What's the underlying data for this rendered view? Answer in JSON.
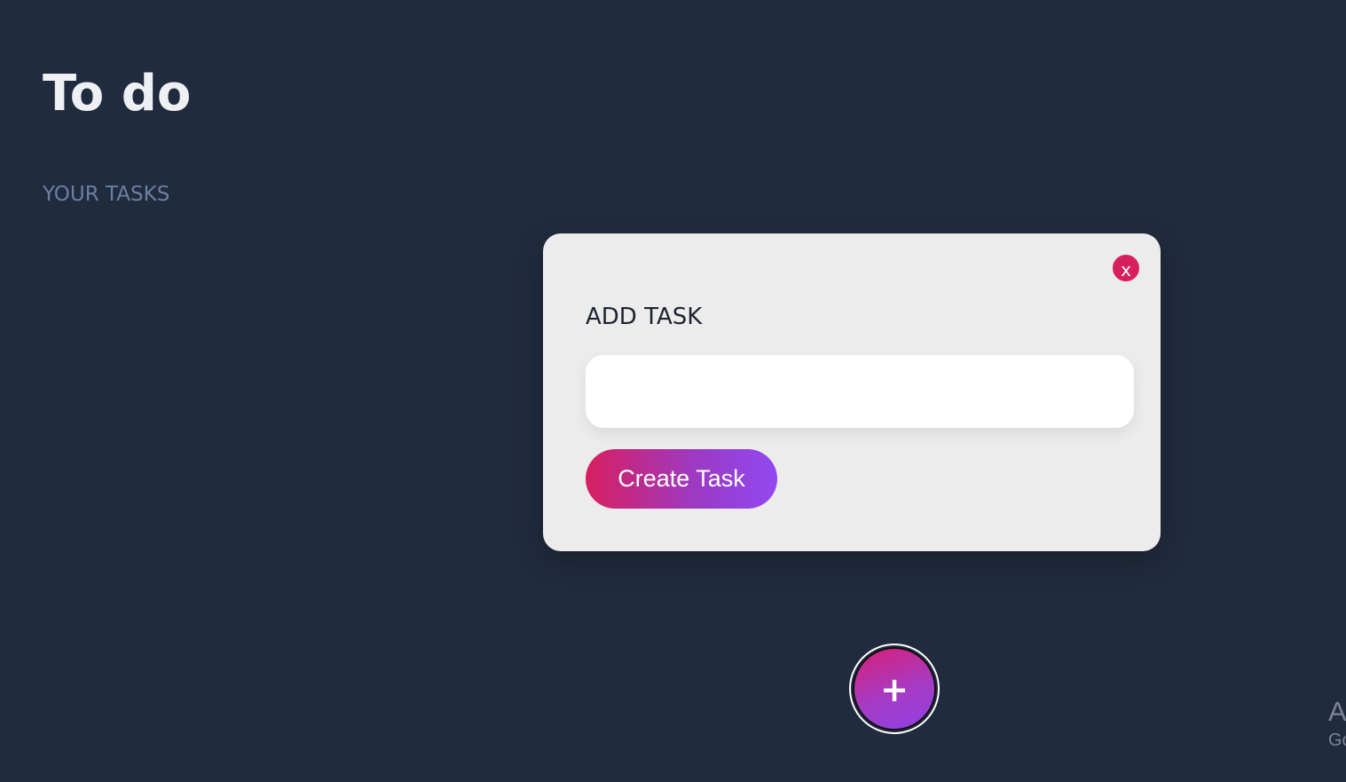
{
  "app": {
    "title": "To do",
    "section_label": "YOUR TASKS"
  },
  "modal": {
    "close_label": "x",
    "heading": "ADD TASK",
    "task_input_value": "",
    "create_button_label": "Create Task"
  },
  "fab": {
    "label": "+",
    "icon": "plus-icon"
  },
  "corner_overlay": {
    "line1": "A",
    "line2": "Go"
  },
  "colors": {
    "background": "#212b3e",
    "title_text": "#eef0f4",
    "section_label_text": "#6b7fa3",
    "modal_background": "#ececec",
    "accent_pink": "#d81f5e",
    "accent_purple": "#9248f0",
    "close_button": "#d81f5e"
  }
}
